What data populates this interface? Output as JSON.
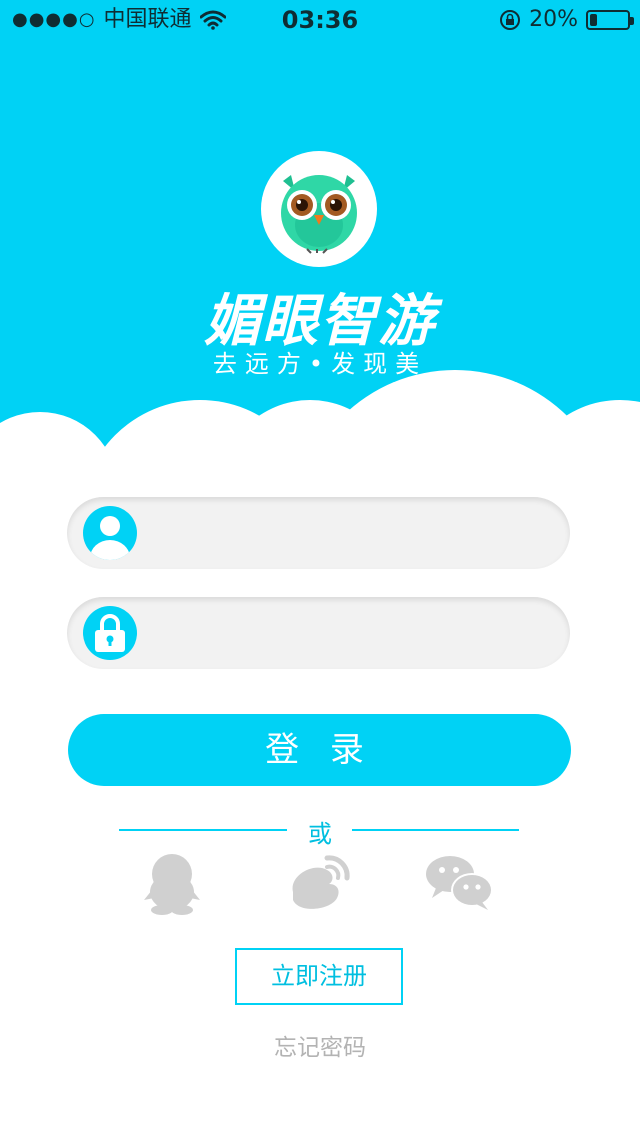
{
  "status_bar": {
    "signal": "●●●●○",
    "carrier": "中国联通",
    "time": "03:36",
    "battery_text": "20%",
    "battery_level": 0.2
  },
  "brand": {
    "name": "媚眼智游",
    "tagline": "去远方•发现美"
  },
  "login_form": {
    "username_placeholder": "",
    "password_placeholder": "",
    "login_label": "登 录"
  },
  "divider": {
    "text": "或"
  },
  "social": [
    "qq-icon",
    "weibo-icon",
    "wechat-icon"
  ],
  "register_label": "立即注册",
  "forgot_label": "忘记密码",
  "colors": {
    "accent": "#00d2f5",
    "accent_text": "#00bfe0",
    "muted": "#b3b3b3",
    "social_gray": "#d0d0d0",
    "owl_green": "#2fd7a6"
  }
}
